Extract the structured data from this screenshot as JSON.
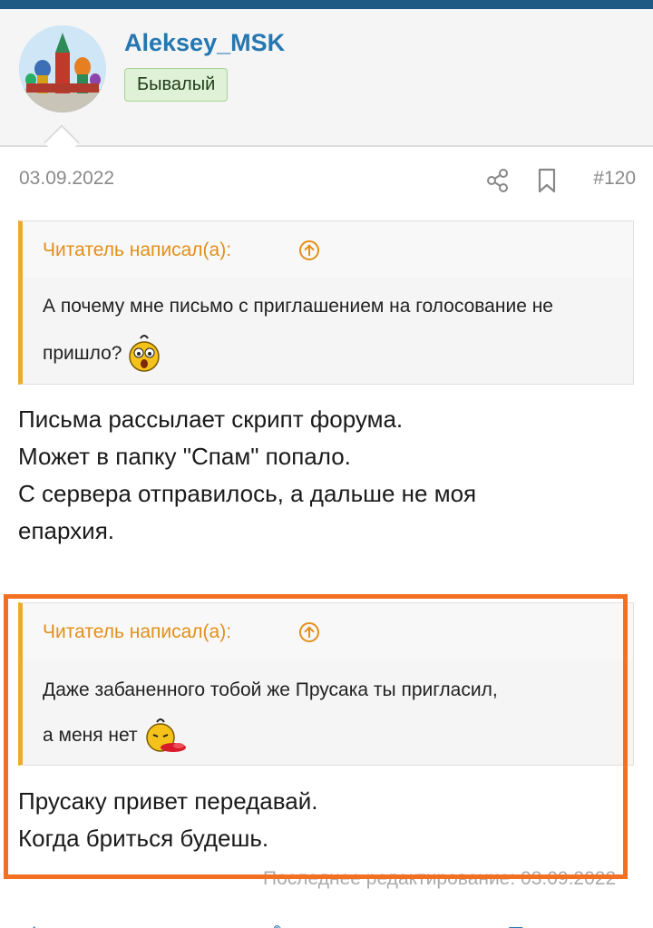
{
  "user": {
    "name": "Aleksey_MSK",
    "rank": "Бывалый"
  },
  "post": {
    "date": "03.09.2022",
    "number": "#120"
  },
  "quote1": {
    "author": "Читатель написал(а):",
    "text": "А почему мне письмо с приглашением на голосование не пришло?"
  },
  "message1": {
    "lines": [
      "Письма рассылает скрипт форума.",
      "Может в папку \"Спам\" попало.",
      "С сервера отправилось, а дальше не моя",
      "епархия."
    ]
  },
  "quote2": {
    "author": "Читатель написал(а):",
    "line1": "Даже забаненного тобой же Прусака ты пригласил,",
    "line2": "а меня нет"
  },
  "message2": {
    "lines": [
      "Прусаку привет передавай.",
      "Когда бриться будешь."
    ]
  },
  "footer": {
    "edited": "Последнее редактирование: 03.09.2022"
  },
  "colors": {
    "accent": "#2577b1",
    "quote_border": "#f0a92f",
    "highlight": "#f36f21"
  }
}
